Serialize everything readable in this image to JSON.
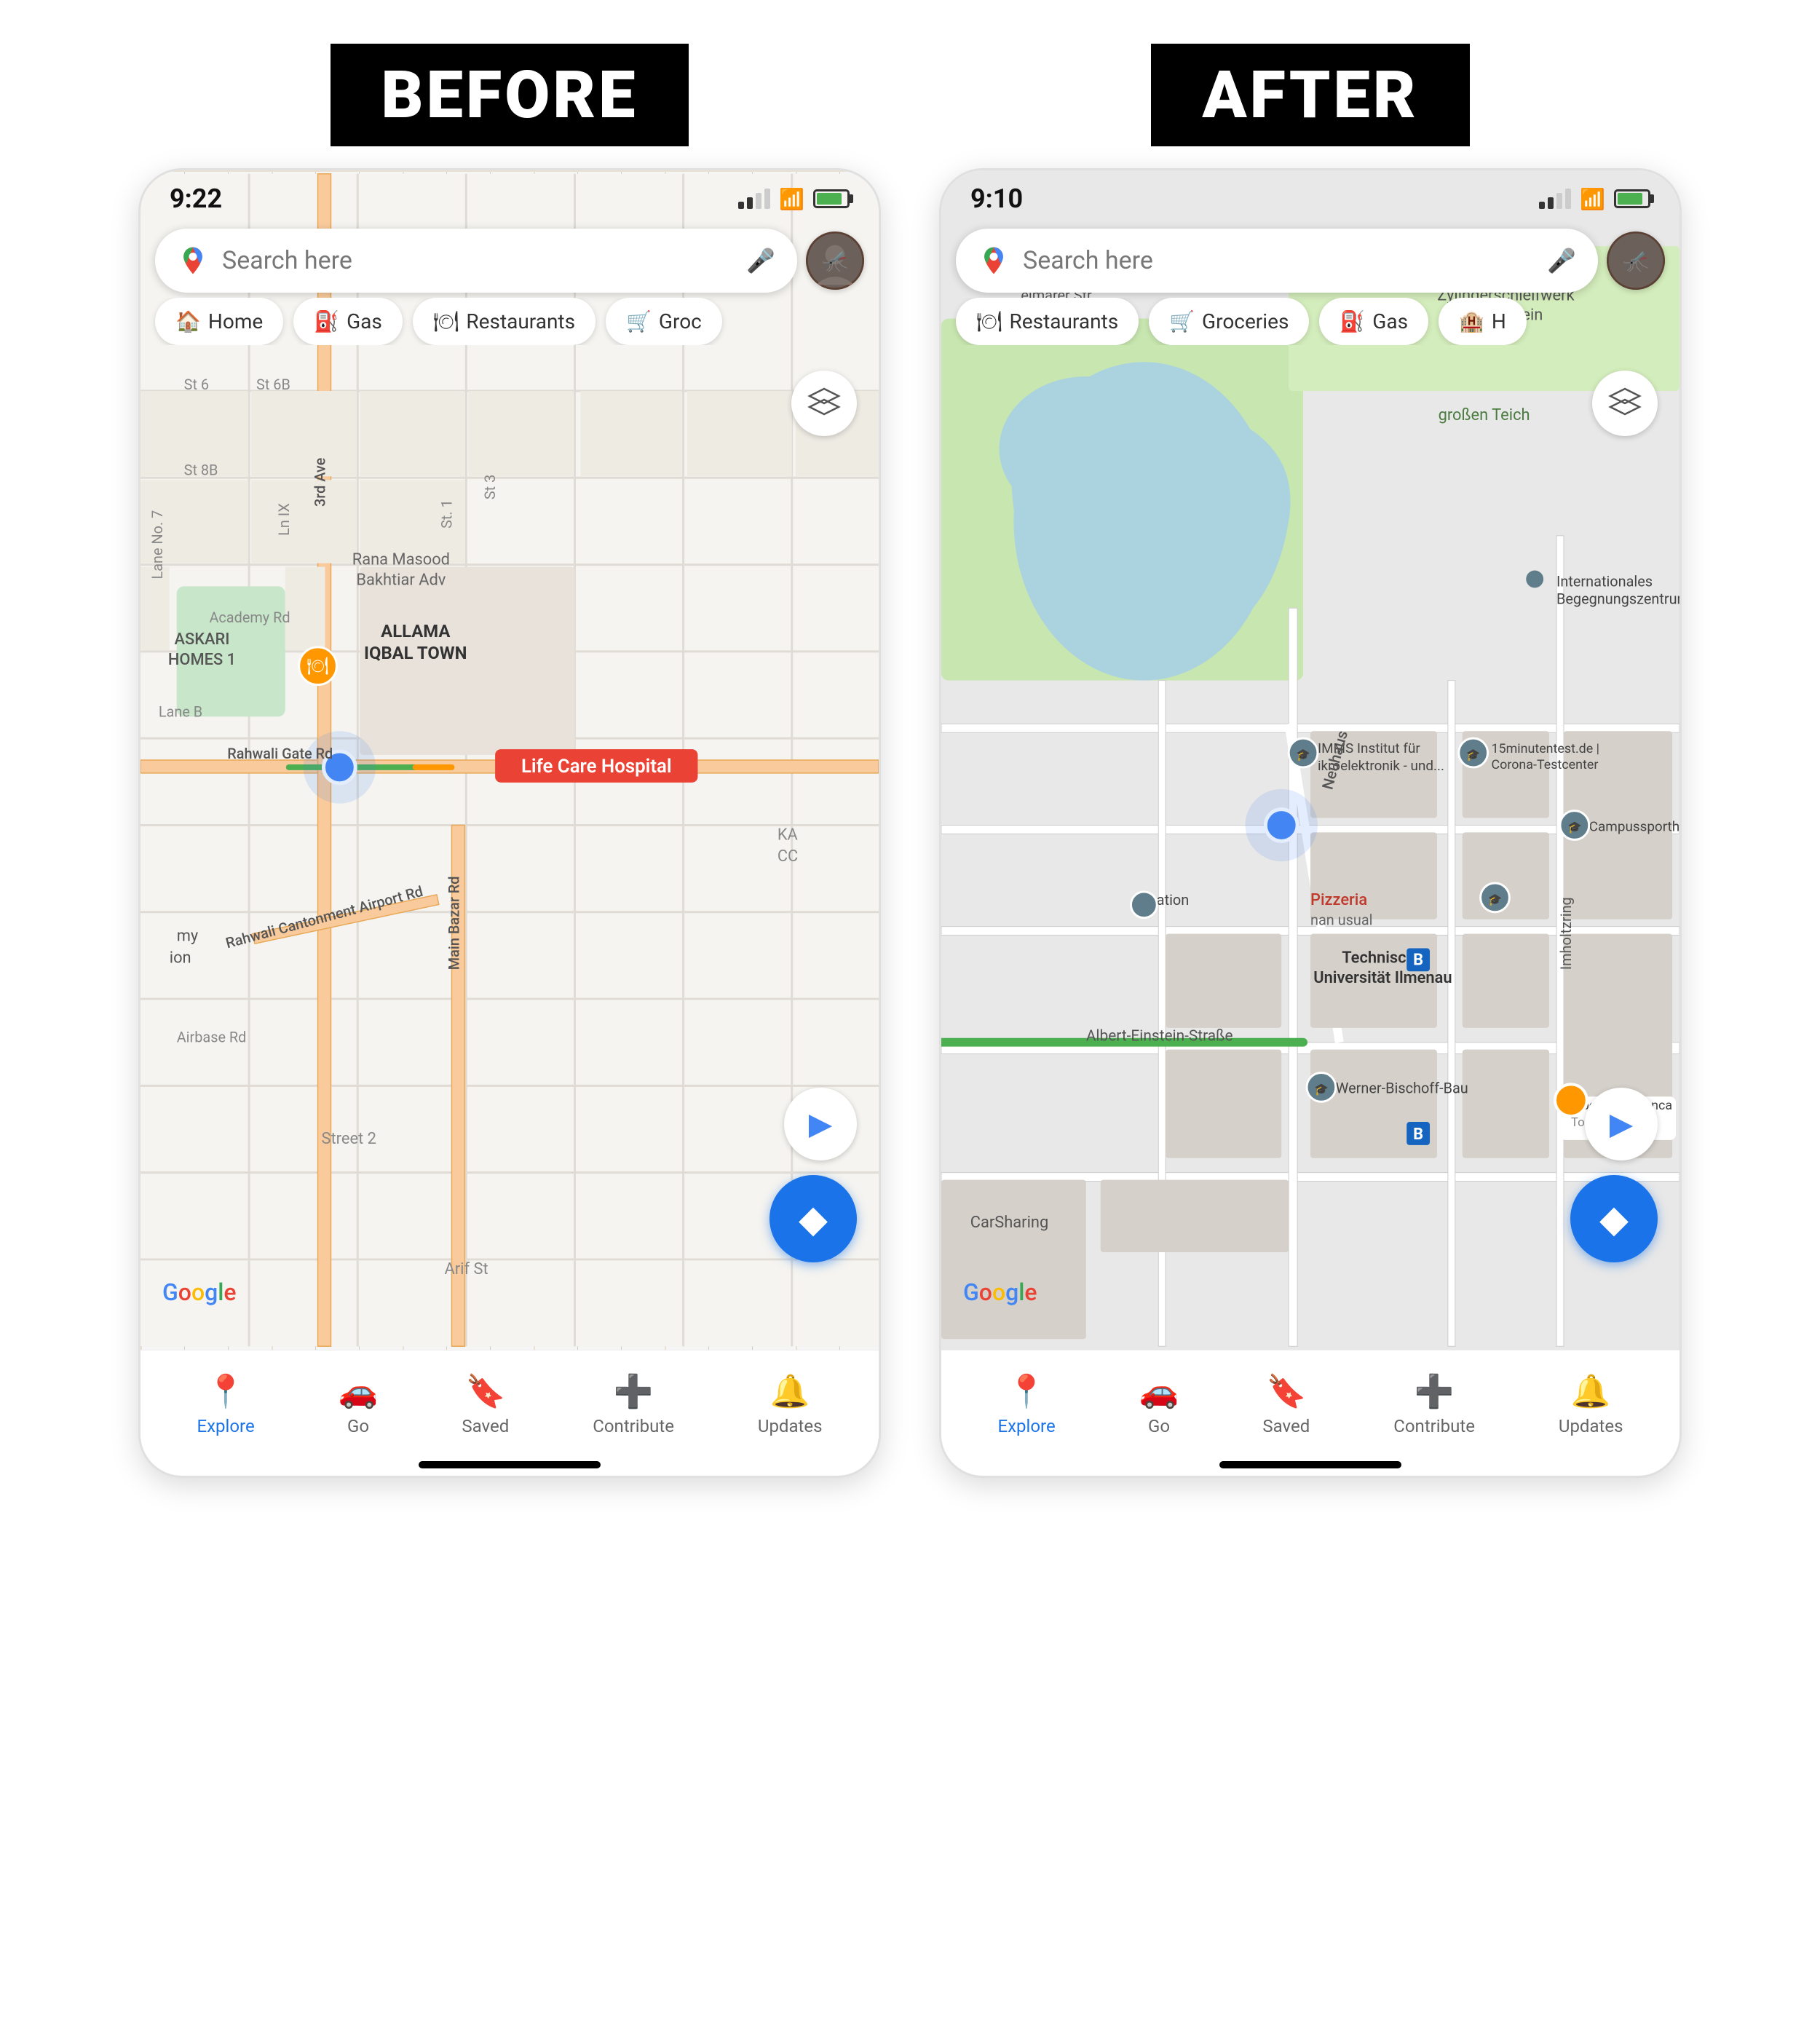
{
  "before": {
    "label": "BEFORE",
    "status": {
      "time": "9:22",
      "location_arrow": "➤"
    },
    "search": {
      "placeholder": "Search here"
    },
    "chips": [
      {
        "icon": "🏠",
        "label": "Home"
      },
      {
        "icon": "⛽",
        "label": "Gas"
      },
      {
        "icon": "🍽",
        "label": "Restaurants"
      },
      {
        "icon": "🛒",
        "label": "Groc"
      }
    ],
    "map": {
      "place1": "ASKARI\nHOMES 1",
      "place2": "ALLAMA\nIQBAL TOWN",
      "hospital": "Life Care Hospital",
      "road1": "Rahwali Gate Rd",
      "road2": "3rd Ave",
      "road3": "Main Bazar Rd",
      "road4": "Rahwali Cantonment Airport Rd",
      "road5": "Street 2",
      "road6": "Arif St",
      "road7": "Academy Rd",
      "area1": "Lane No. 7",
      "area2": "Lane B",
      "area3": "St 6",
      "area4": "St 6B",
      "area5": "St 8B",
      "area6": "Ln IX",
      "area7": "St. 1",
      "area8": "St 3",
      "area9": "Airbase Rd",
      "area10": "KA CC"
    },
    "nav": [
      {
        "icon": "📍",
        "label": "Explore",
        "active": true
      },
      {
        "icon": "🚗",
        "label": "Go",
        "active": false
      },
      {
        "icon": "🔖",
        "label": "Saved",
        "active": false
      },
      {
        "icon": "➕",
        "label": "Contribute",
        "active": false
      },
      {
        "icon": "🔔",
        "label": "Updates",
        "active": false
      }
    ]
  },
  "after": {
    "label": "AFTER",
    "status": {
      "time": "9:10",
      "location_arrow": "➤"
    },
    "search": {
      "placeholder": "Search here"
    },
    "chips": [
      {
        "icon": "🍽",
        "label": "Restaurants"
      },
      {
        "icon": "🛒",
        "label": "Groceries"
      },
      {
        "icon": "⛽",
        "label": "Gas"
      },
      {
        "icon": "🏨",
        "label": "H"
      }
    ],
    "map": {
      "place1": "Internationales\nBegegnungszentrum",
      "place2": "IMMS Institut für\nikroelektronik - und...",
      "place3": "15minutentest.de |\nCorona-Testcenter",
      "place4": "Campussporthalle",
      "place5": "Technische\nUniversität Ilmenau",
      "place6": "Werner-Bischoff-Bau",
      "place7": "bc-Studentenca\nTop rat...",
      "place8": "Pizzeria\nnan usual",
      "place9": "CarSharing",
      "place10": "Zylinderschleifwerk\nFeuerstein",
      "road1": "Neuhaus",
      "road2": "Albert-Einstein-Straße",
      "road3": "Imholtzring",
      "road4": "eimarer St",
      "label1": "großen Teich",
      "label2": "mation"
    },
    "nav": [
      {
        "icon": "📍",
        "label": "Explore",
        "active": true
      },
      {
        "icon": "🚗",
        "label": "Go",
        "active": false
      },
      {
        "icon": "🔖",
        "label": "Saved",
        "active": false
      },
      {
        "icon": "➕",
        "label": "Contribute",
        "active": false
      },
      {
        "icon": "🔔",
        "label": "Updates",
        "active": false
      }
    ]
  },
  "icons": {
    "layers": "◈",
    "navigate": "▶",
    "directions": "◆",
    "mic": "🎤",
    "signal": "📶",
    "wifi": "📡"
  }
}
